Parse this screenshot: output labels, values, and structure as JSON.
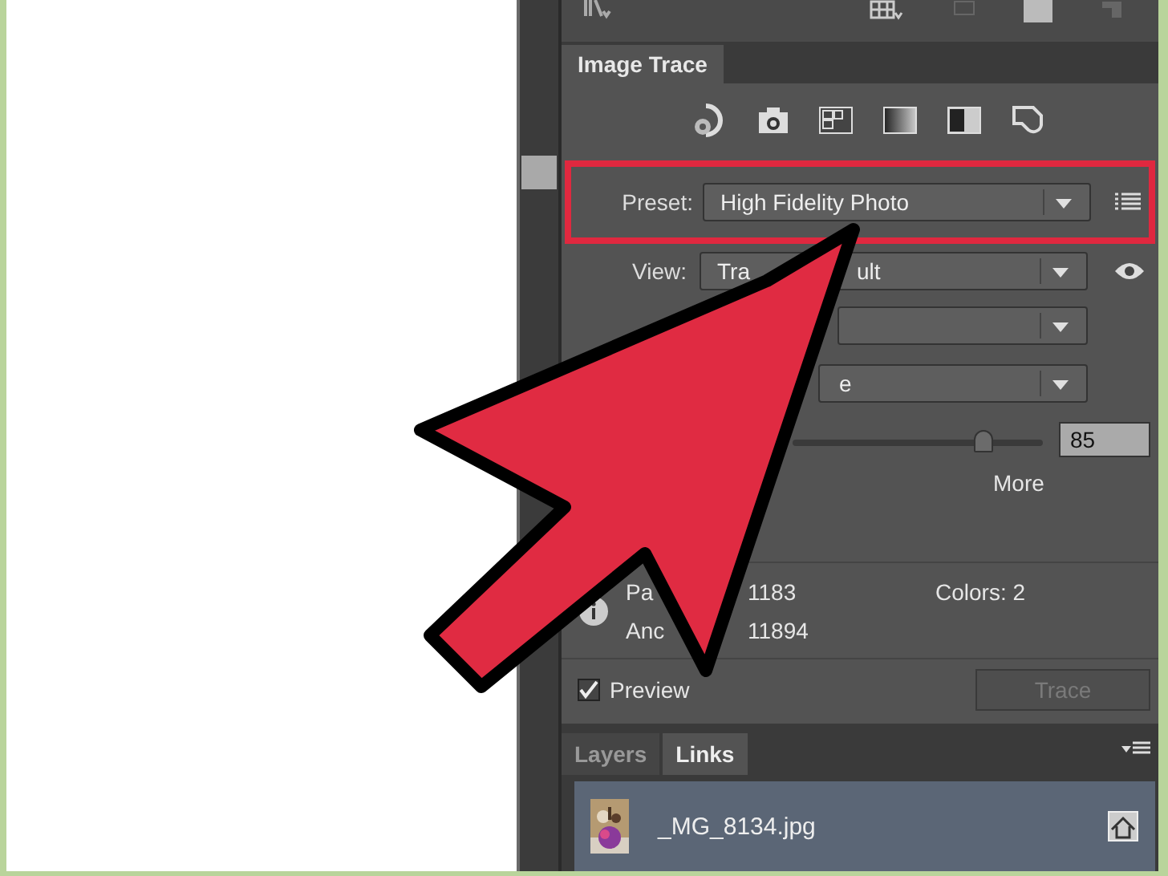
{
  "panel_tabs": [
    {
      "label": "Image Trace",
      "selected": true
    }
  ],
  "preset": {
    "label": "Preset:",
    "value": "High Fidelity Photo",
    "highlighted": true
  },
  "dropdowns": [
    {
      "kind": "view",
      "label": "View:",
      "text_parts": [
        "Tra",
        "ult"
      ]
    },
    {
      "kind": "blank"
    },
    {
      "kind": "plain",
      "text_parts": [
        "e"
      ]
    }
  ],
  "slider": {
    "level": 0.76,
    "value": "85",
    "end_label": "More"
  },
  "info": {
    "paths_label": "Pa",
    "paths": "1183",
    "anchors_label": "Anc",
    "anchors": "11894",
    "colors": "Colors: 2"
  },
  "preview": {
    "label": "Preview",
    "checked": true
  },
  "trace_button": {
    "label": "Trace",
    "disabled": true
  },
  "bottom_tabs": [
    {
      "label": "Layers",
      "selected": false
    },
    {
      "label": "Links",
      "selected": true
    }
  ],
  "links": [
    {
      "name": "_MG_8134.jpg",
      "selected": true
    }
  ]
}
